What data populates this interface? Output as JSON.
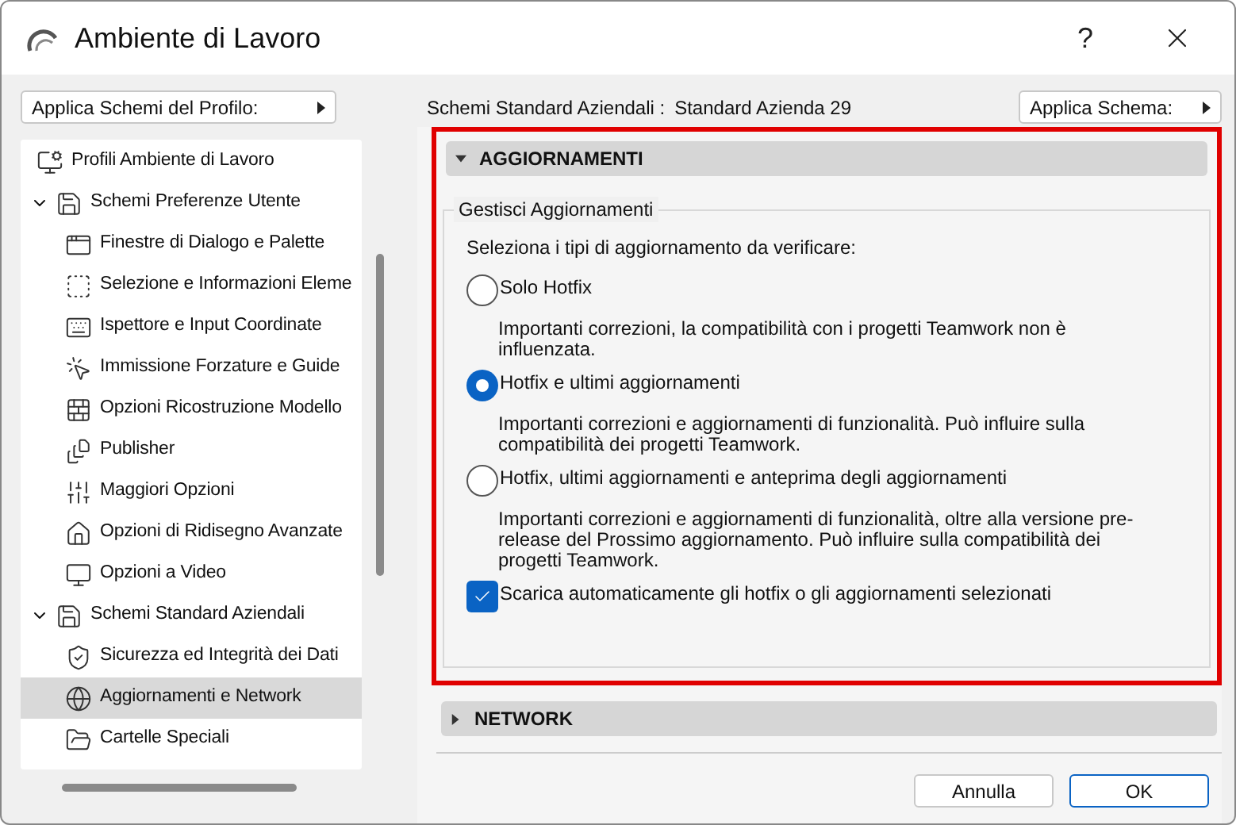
{
  "window": {
    "title": "Ambiente di Lavoro",
    "help": "?"
  },
  "profile_menu": {
    "label": "Applica Schemi del Profilo:"
  },
  "tree": [
    {
      "label": "Profili Ambiente di Lavoro",
      "selected": false
    },
    {
      "label": "Schemi Preferenze Utente",
      "selected": false,
      "expanded": true,
      "children": [
        {
          "label": "Finestre di Dialogo e Palette",
          "selected": false
        },
        {
          "label": "Selezione e Informazioni Eleme",
          "selected": false
        },
        {
          "label": "Ispettore e Input Coordinate",
          "selected": false
        },
        {
          "label": "Immissione Forzature e Guide",
          "selected": false
        },
        {
          "label": "Opzioni Ricostruzione Modello",
          "selected": false
        },
        {
          "label": "Publisher",
          "selected": false
        },
        {
          "label": "Maggiori Opzioni",
          "selected": false
        },
        {
          "label": "Opzioni di Ridisegno Avanzate",
          "selected": false
        },
        {
          "label": "Opzioni a Video",
          "selected": false
        }
      ]
    },
    {
      "label": "Schemi Standard Aziendali",
      "selected": false,
      "expanded": true,
      "children": [
        {
          "label": "Sicurezza ed Integrità dei Dati",
          "selected": false
        },
        {
          "label": "Aggiornamenti e Network",
          "selected": true
        },
        {
          "label": "Cartelle Speciali",
          "selected": false
        }
      ]
    }
  ],
  "scheme": {
    "label": "Schemi Standard Aziendali :",
    "value": "Standard Azienda 29",
    "apply": "Applica Schema:"
  },
  "sections": [
    {
      "title": "AGGIORNAMENTI",
      "expanded": true,
      "group": {
        "title": "Gestisci Aggiornamenti",
        "prompt": "Seleziona i tipi di aggiornamento da verificare:",
        "options": [
          {
            "label": "Solo Hotfix",
            "description": "Importanti correzioni, la compatibilità con i progetti Teamwork non è influenzata.",
            "selected": false
          },
          {
            "label": "Hotfix e ultimi aggiornamenti",
            "description": "Importanti correzioni e aggiornamenti di funzionalità. Può influire sulla compatibilità dei progetti Teamwork.",
            "selected": true
          },
          {
            "label": "Hotfix, ultimi aggiornamenti e anteprima degli aggiornamenti",
            "description": "Importanti correzioni e aggiornamenti di funzionalità, oltre alla versione pre-release del Prossimo aggiornamento. Può influire sulla compatibilità dei progetti Teamwork.",
            "selected": false
          }
        ],
        "auto_download": {
          "label": "Scarica automaticamente gli hotfix o gli aggiornamenti selezionati",
          "checked": true
        }
      }
    },
    {
      "title": "NETWORK",
      "expanded": false
    }
  ],
  "buttons": [
    "Annulla",
    "OK"
  ]
}
